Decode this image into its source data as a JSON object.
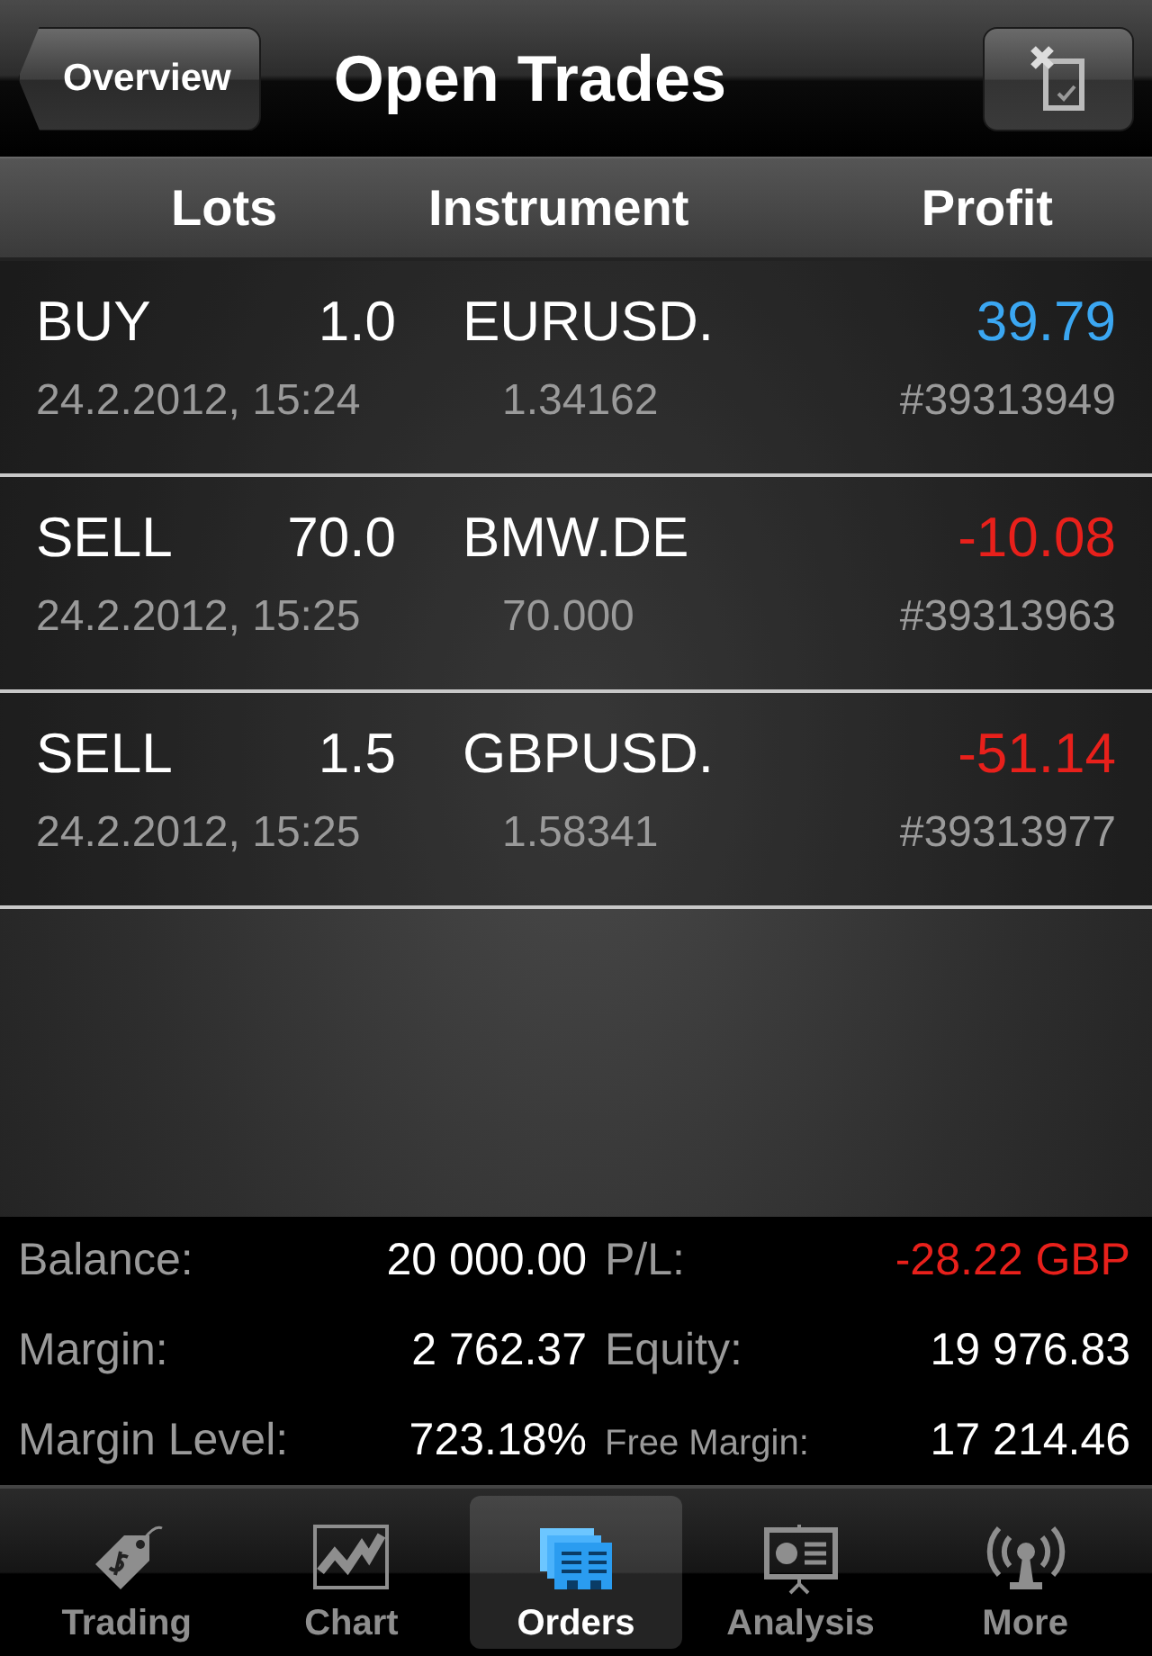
{
  "nav": {
    "back": "Overview",
    "title": "Open Trades"
  },
  "columns": [
    "Lots",
    "Instrument",
    "Profit"
  ],
  "trades": [
    {
      "side": "BUY",
      "lots": "1.0",
      "instrument": "EURUSD.",
      "profit": "39.79",
      "color": "#3ba7f2",
      "time": "24.2.2012, 15:24",
      "price": "1.34162",
      "ticket": "#39313949"
    },
    {
      "side": "SELL",
      "lots": "70.0",
      "instrument": "BMW.DE",
      "profit": "-10.08",
      "color": "#e8201b",
      "time": "24.2.2012, 15:25",
      "price": "70.000",
      "ticket": "#39313963"
    },
    {
      "side": "SELL",
      "lots": "1.5",
      "instrument": "GBPUSD.",
      "profit": "-51.14",
      "color": "#e8201b",
      "time": "24.2.2012, 15:25",
      "price": "1.58341",
      "ticket": "#39313977"
    }
  ],
  "summary": [
    {
      "label": "Balance:",
      "value": "20 000.00",
      "color": "#ffffff",
      "small": false
    },
    {
      "label": "P/L:",
      "value": "-28.22 GBP",
      "color": "#e8201b",
      "small": false
    },
    {
      "label": "Margin:",
      "value": "2 762.37",
      "color": "#ffffff",
      "small": false
    },
    {
      "label": "Equity:",
      "value": "19 976.83",
      "color": "#ffffff",
      "small": false
    },
    {
      "label": "Margin Level:",
      "value": "723.18%",
      "color": "#ffffff",
      "small": false
    },
    {
      "label": "Free Margin:",
      "value": "17 214.46",
      "color": "#ffffff",
      "small": true
    }
  ],
  "tabs": [
    {
      "label": "Trading",
      "kind": "tag",
      "selected": false
    },
    {
      "label": "Chart",
      "kind": "chart",
      "selected": false
    },
    {
      "label": "Orders",
      "kind": "orders",
      "selected": true
    },
    {
      "label": "Analysis",
      "kind": "presentation",
      "selected": false
    },
    {
      "label": "More",
      "kind": "antenna",
      "selected": false
    }
  ]
}
